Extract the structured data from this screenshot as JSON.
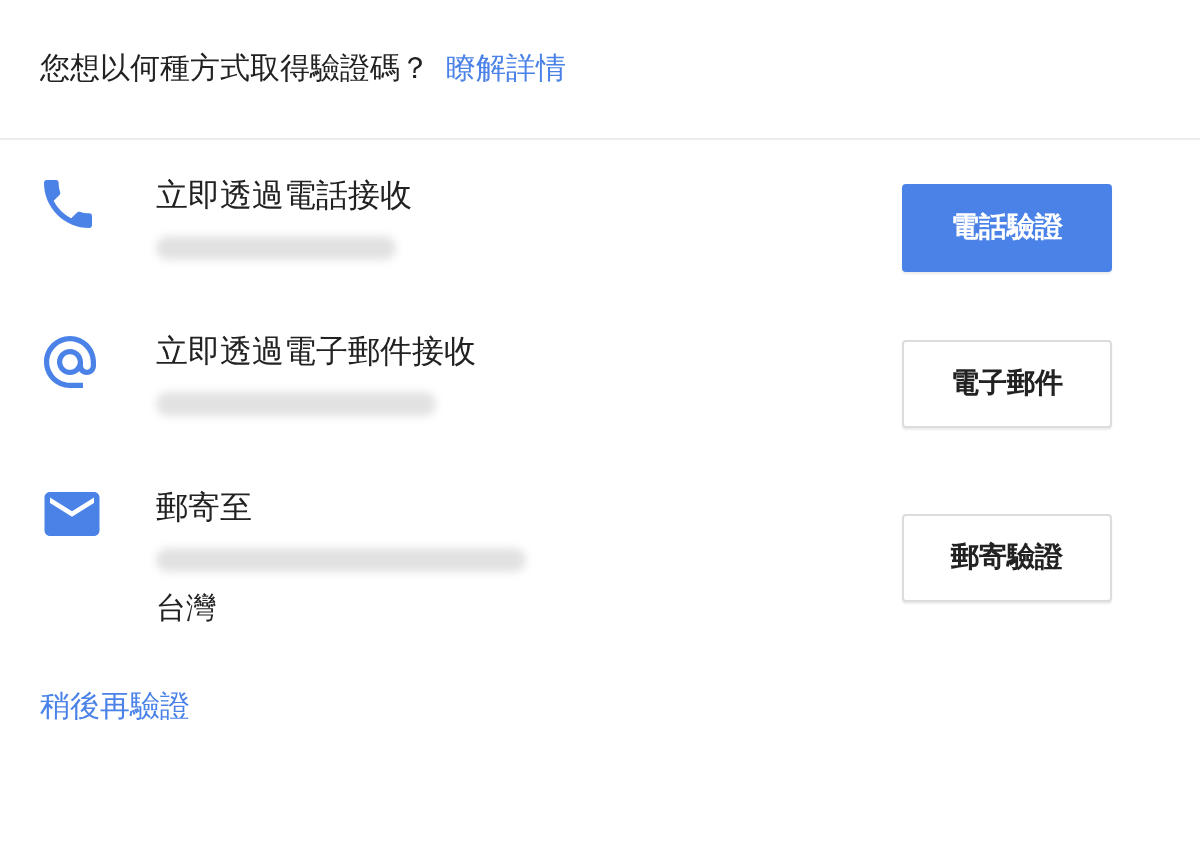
{
  "header": {
    "question": "您想以何種方式取得驗證碼？",
    "link": "瞭解詳情"
  },
  "options": [
    {
      "kind": "phone",
      "title": "立即透過電話接收",
      "details": [
        {
          "kind": "redacted"
        }
      ],
      "button": {
        "label": "電話驗證",
        "primary": true
      }
    },
    {
      "kind": "email",
      "title": "立即透過電子郵件接收",
      "details": [
        {
          "kind": "redacted"
        }
      ],
      "button": {
        "label": "電子郵件",
        "primary": false
      }
    },
    {
      "kind": "mail",
      "title": "郵寄至",
      "details": [
        {
          "kind": "redacted"
        },
        {
          "kind": "text",
          "text": "台灣"
        }
      ],
      "button": {
        "label": "郵寄驗證",
        "primary": false
      }
    }
  ],
  "footer_link": "稍後再驗證"
}
